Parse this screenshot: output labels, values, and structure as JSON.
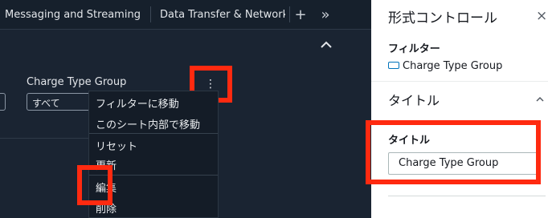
{
  "tabs": {
    "items": [
      {
        "label": "Messaging and Streaming"
      },
      {
        "label": "Data Transfer & Networking"
      }
    ],
    "add_label": "+",
    "more_label": "»"
  },
  "filter_control": {
    "label": "Charge Type Group",
    "selected_value": "すべて",
    "kebab_label": "⋮"
  },
  "context_menu": {
    "items": [
      {
        "label": "フィルターに移動"
      },
      {
        "label": "このシート内部で移動"
      },
      {
        "label": "リセット"
      },
      {
        "label": "更新"
      },
      {
        "label": "編集"
      },
      {
        "label": "削除"
      }
    ]
  },
  "format_panel": {
    "title": "形式コントロール",
    "close_label": "×",
    "filter_section_label": "フィルター",
    "filter_name": "Charge Type Group",
    "title_section_label": "タイトル",
    "title_field_label": "タイトル",
    "title_field_kebab": "⋮",
    "title_field_value": "Charge Type Group"
  },
  "colors": {
    "highlight": "#ff2a10",
    "dark_bg": "#1a2432",
    "accent": "#0073bb"
  }
}
